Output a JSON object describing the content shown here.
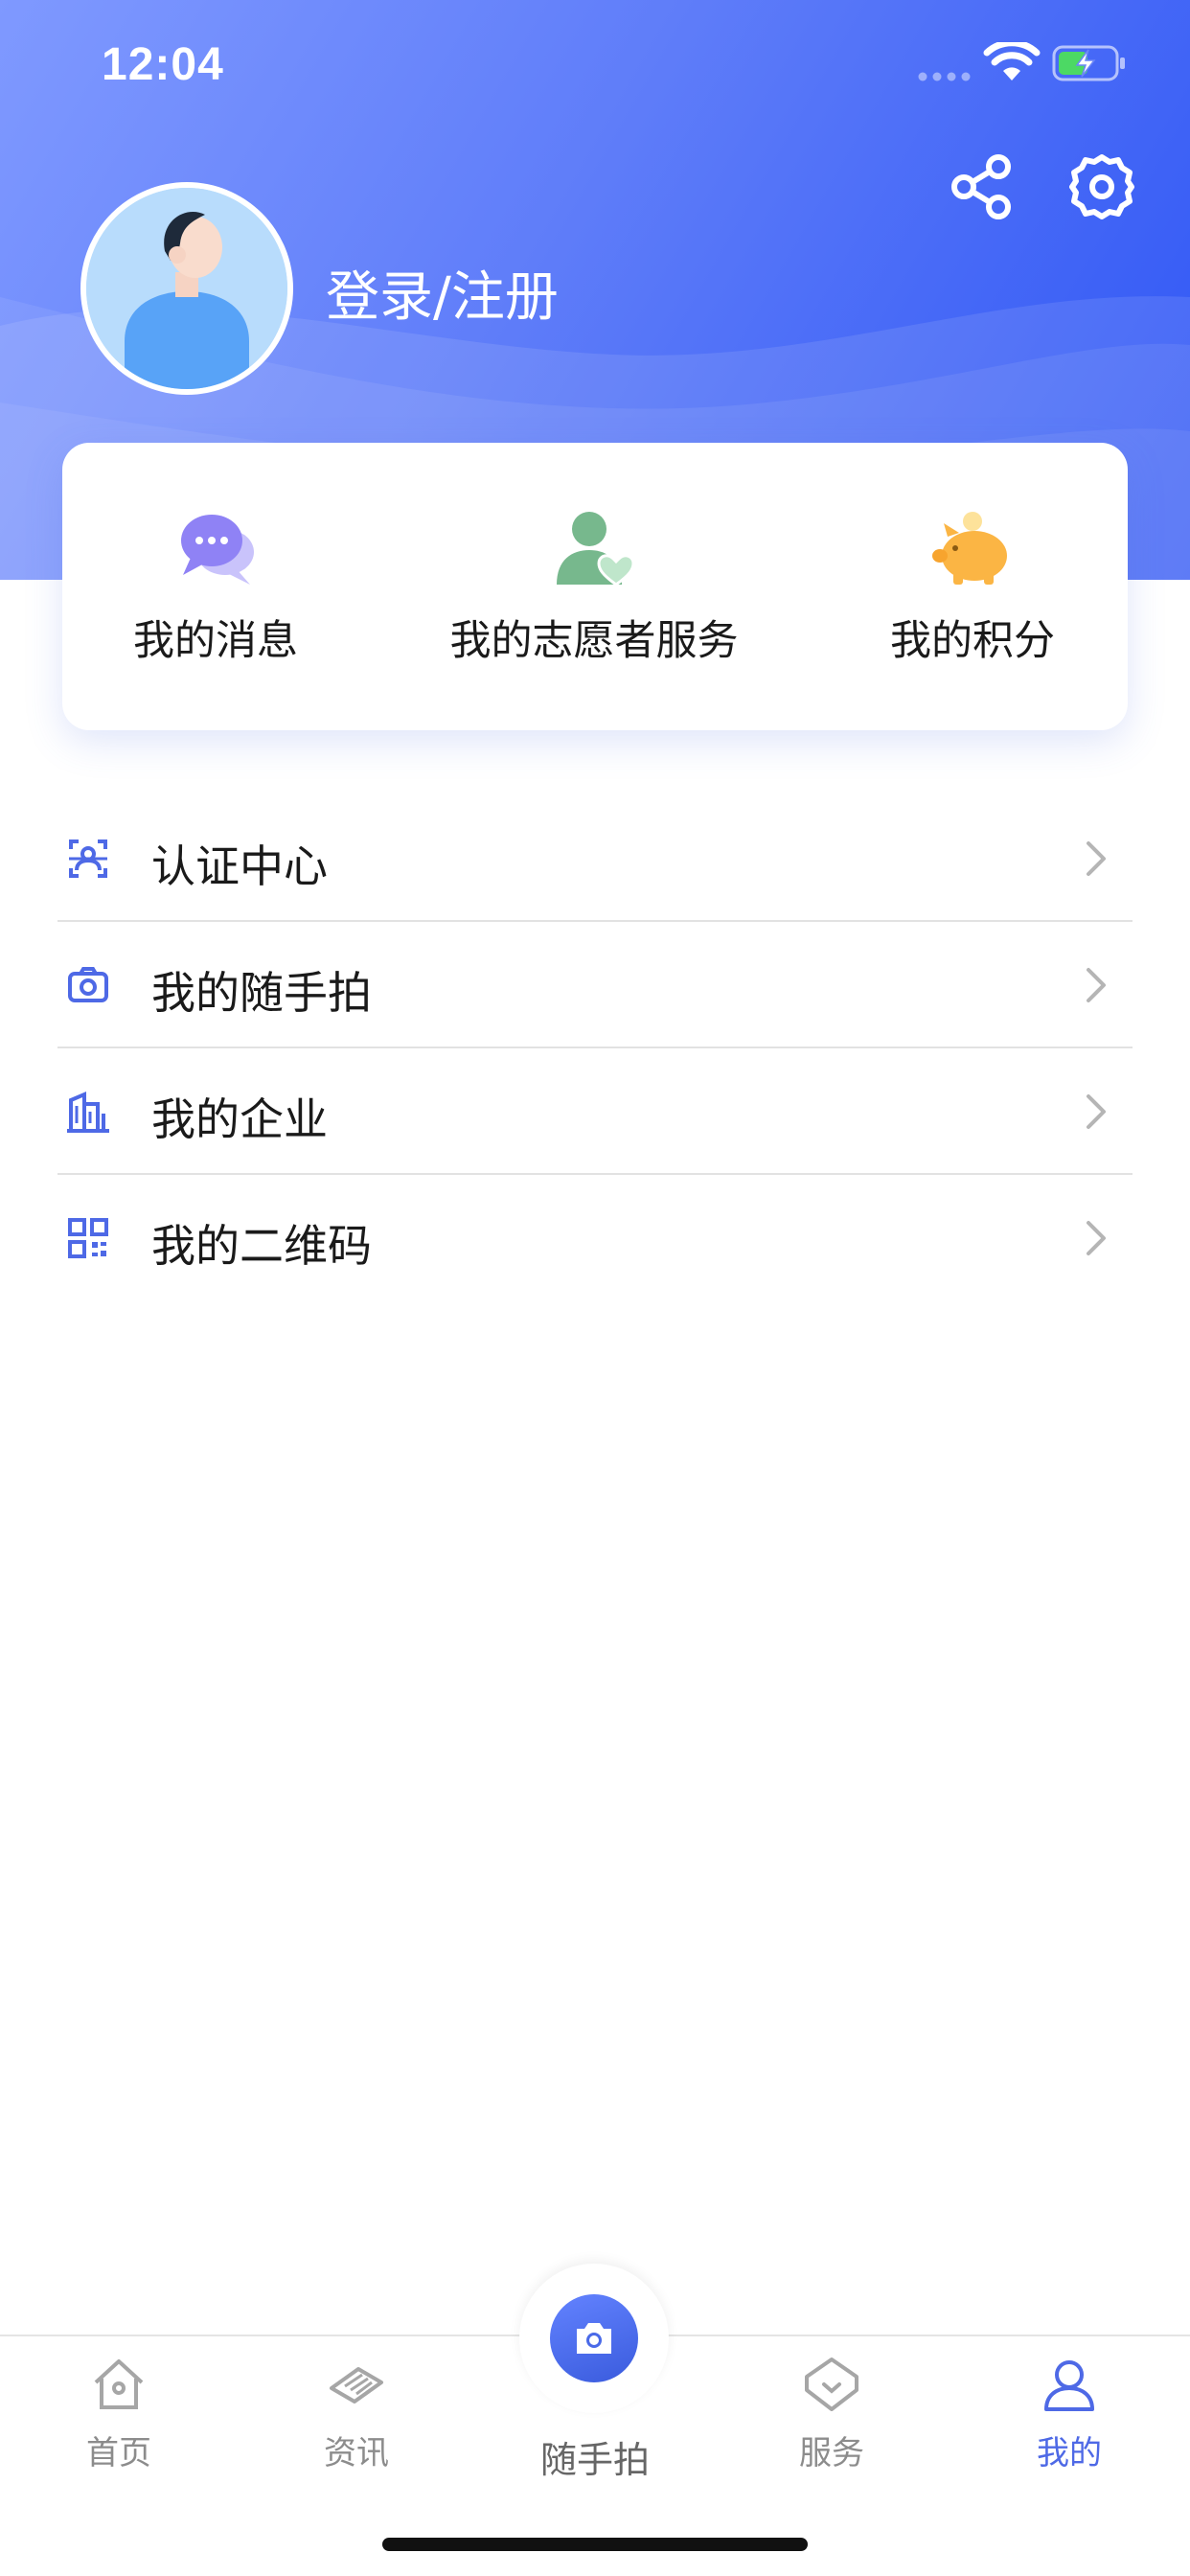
{
  "status_bar": {
    "time": "12:04",
    "icons": [
      "signal-icon",
      "wifi-icon",
      "battery-charging-icon"
    ]
  },
  "header": {
    "login_text": "登录/注册",
    "icons": [
      "share-icon",
      "gear-icon"
    ],
    "colors": {
      "gradient_start": "#7f99ff",
      "gradient_end": "#2f56f5"
    }
  },
  "quick_actions": [
    {
      "label": "我的消息",
      "icon": "chat-bubble-icon"
    },
    {
      "label": "我的志愿者服务",
      "icon": "volunteer-heart-icon"
    },
    {
      "label": "我的积分",
      "icon": "piggy-bank-icon"
    }
  ],
  "menu": [
    {
      "label": "认证中心",
      "icon": "face-scan-icon"
    },
    {
      "label": "我的随手拍",
      "icon": "camera-icon"
    },
    {
      "label": "我的企业",
      "icon": "building-icon"
    },
    {
      "label": "我的二维码",
      "icon": "qr-code-icon"
    }
  ],
  "tabbar": {
    "tabs": [
      {
        "label": "首页",
        "icon": "home-icon",
        "active": false
      },
      {
        "label": "资讯",
        "icon": "news-icon",
        "active": false
      },
      {
        "label": "随手拍",
        "icon": "camera-icon",
        "active": false
      },
      {
        "label": "服务",
        "icon": "service-icon",
        "active": false
      },
      {
        "label": "我的",
        "icon": "user-icon",
        "active": true
      }
    ],
    "colors": {
      "active": "#4e69e6",
      "inactive": "#8c8c8c"
    }
  }
}
